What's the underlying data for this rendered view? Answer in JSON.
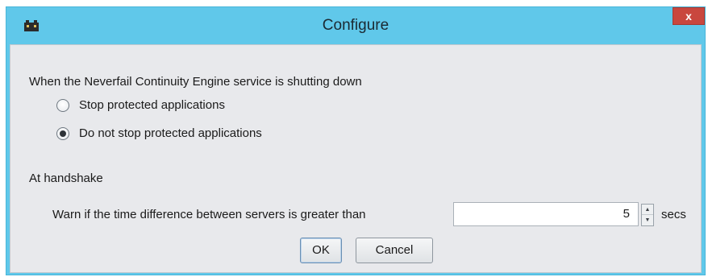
{
  "window": {
    "title": "Configure",
    "close_label": "x",
    "icon": "app-icon"
  },
  "shutdown": {
    "label": "When the Neverfail Continuity Engine service is shutting down",
    "options": [
      {
        "label": "Stop protected applications",
        "selected": false
      },
      {
        "label": "Do not stop protected applications",
        "selected": true
      }
    ]
  },
  "handshake": {
    "label": "At handshake",
    "warn_label": "Warn if the time difference between servers is greater than",
    "value": "5",
    "unit": "secs"
  },
  "buttons": {
    "ok": "OK",
    "cancel": "Cancel"
  }
}
